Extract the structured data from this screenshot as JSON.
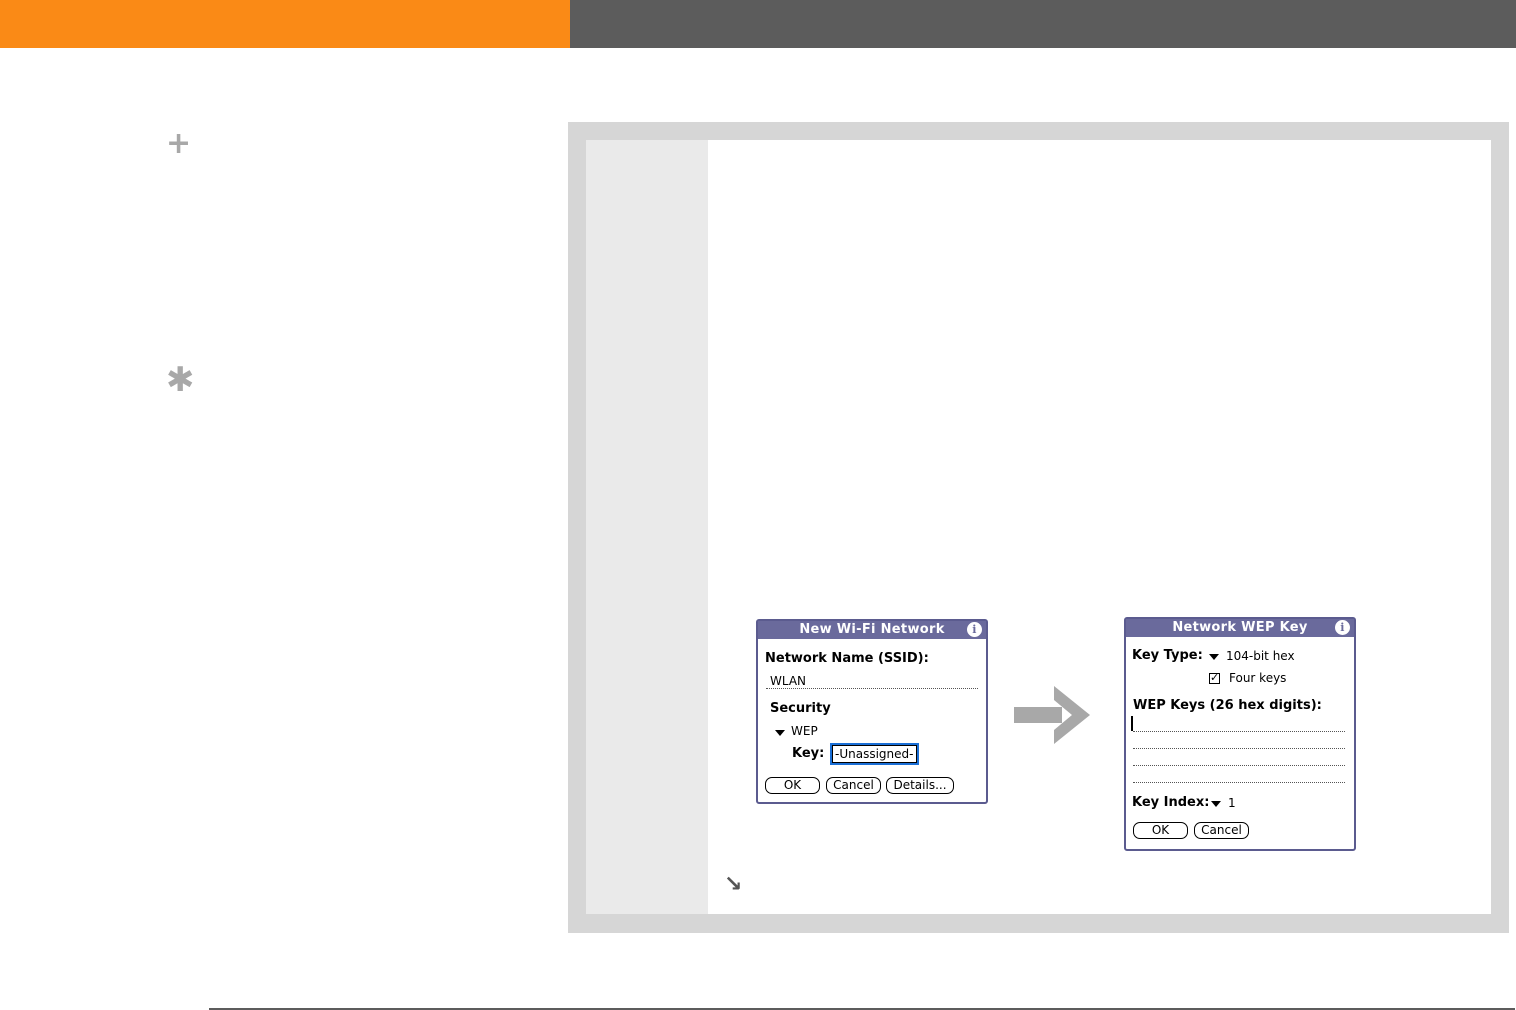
{
  "colors": {
    "orange_bar": "#fa8a16",
    "gray_bar": "#5c5c5c",
    "dialog_title_bg": "#6a6a9c",
    "key_highlight": "#1a6fd6"
  },
  "sidebar": {
    "tip_icon": "plus-icon",
    "tip_symbol": "+",
    "note_icon": "asterisk-icon",
    "note_symbol": "✱"
  },
  "dialog_new_wifi": {
    "title": "New Wi-Fi Network",
    "info_glyph": "i",
    "network_name_label": "Network Name (SSID):",
    "network_name_value": "WLAN",
    "security_label": "Security",
    "security_value": "WEP",
    "key_label": "Key:",
    "key_value": "-Unassigned-",
    "ok_label": "OK",
    "cancel_label": "Cancel",
    "details_label": "Details..."
  },
  "dialog_wep_key": {
    "title": "Network WEP Key",
    "info_glyph": "i",
    "key_type_label": "Key Type:",
    "key_type_value": "104-bit hex",
    "four_keys_label": "Four keys",
    "four_keys_checked": true,
    "check_glyph": "✓",
    "wep_keys_label": "WEP Keys (26 hex digits):",
    "key_index_label": "Key Index:",
    "key_index_value": "1",
    "ok_label": "OK",
    "cancel_label": "Cancel"
  },
  "flow_arrow": "arrow-right-icon",
  "continue_icon": "continue-arrow-icon",
  "continue_glyph": "↘"
}
